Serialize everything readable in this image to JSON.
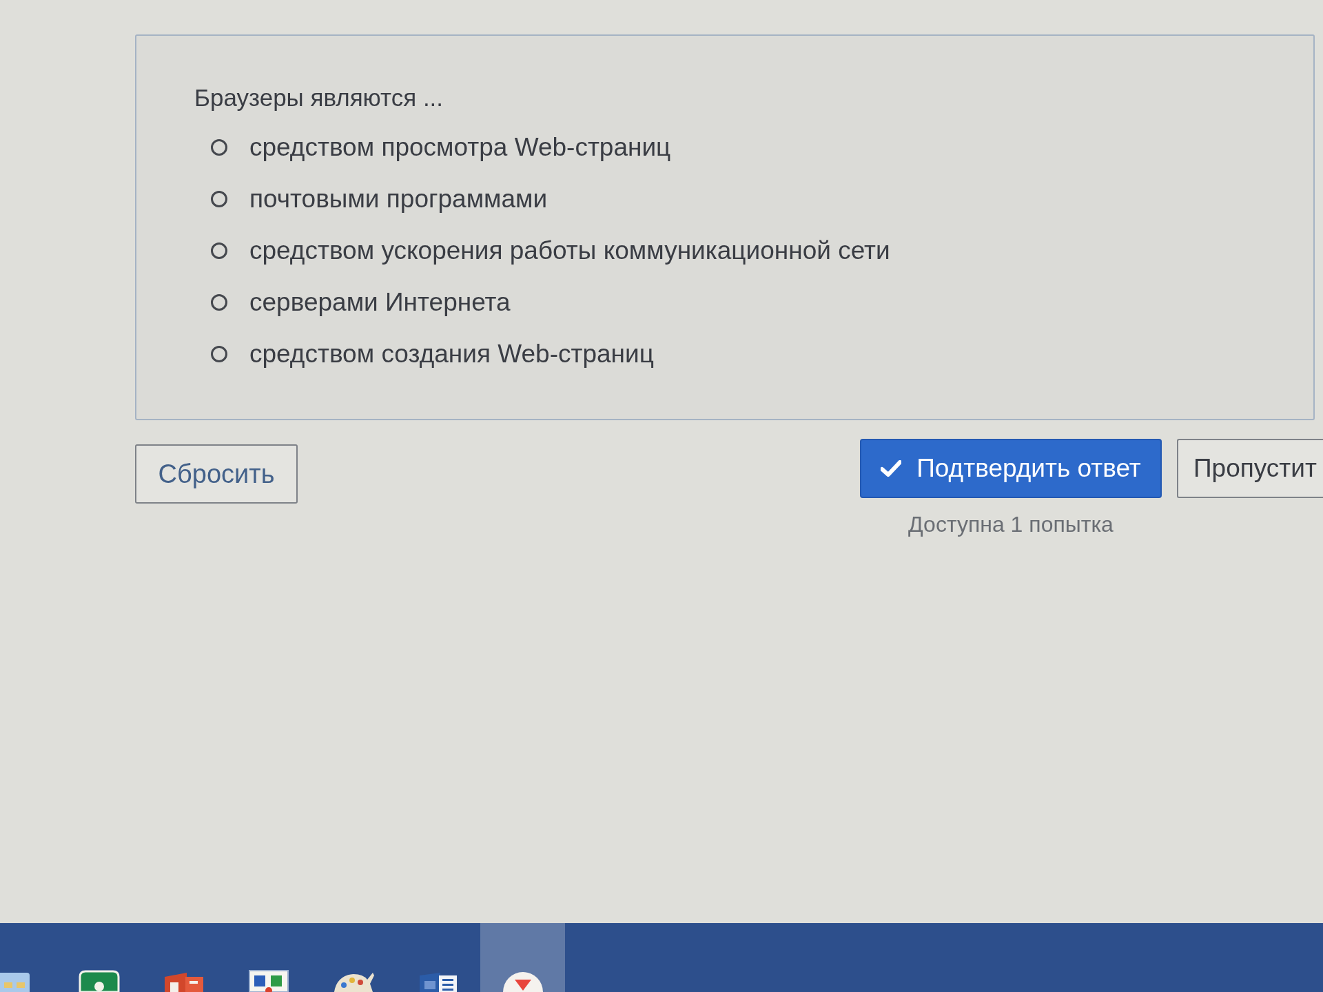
{
  "question": {
    "text": "Браузеры являются ...",
    "options": [
      {
        "label": "средством просмотра Web-страниц",
        "selected": false
      },
      {
        "label": "почтовыми программами",
        "selected": false
      },
      {
        "label": "средством ускорения работы коммуникационной сети",
        "selected": false
      },
      {
        "label": "серверами Интернета",
        "selected": false
      },
      {
        "label": "средством создания Web-страниц",
        "selected": false
      }
    ]
  },
  "buttons": {
    "reset": "Сбросить",
    "submit": "Подтвердить ответ",
    "skip": "Пропустит"
  },
  "attempts_note": "Доступна 1 попытка",
  "taskbar": {
    "items": [
      {
        "kind": "folder",
        "selected": false
      },
      {
        "kind": "tile",
        "selected": false
      },
      {
        "kind": "slides",
        "selected": false
      },
      {
        "kind": "book",
        "selected": false
      },
      {
        "kind": "palette",
        "selected": false
      },
      {
        "kind": "document",
        "selected": false
      },
      {
        "kind": "browser",
        "selected": true
      }
    ]
  }
}
